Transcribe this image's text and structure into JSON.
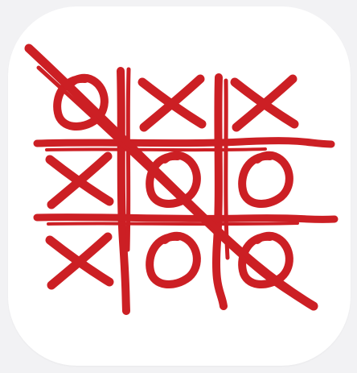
{
  "app_icon": {
    "name": "tic-tac-toe-app-icon",
    "background_color": "#ffffff",
    "page_color": "#f2f2f4",
    "ink_color": "#cc1f24"
  },
  "game": {
    "board": [
      [
        "O",
        "X",
        "X"
      ],
      [
        "X",
        "O",
        "O"
      ],
      [
        "X",
        "O",
        "O"
      ]
    ],
    "winner": "O",
    "winning_line": "diagonal-top-left-to-bottom-right"
  }
}
